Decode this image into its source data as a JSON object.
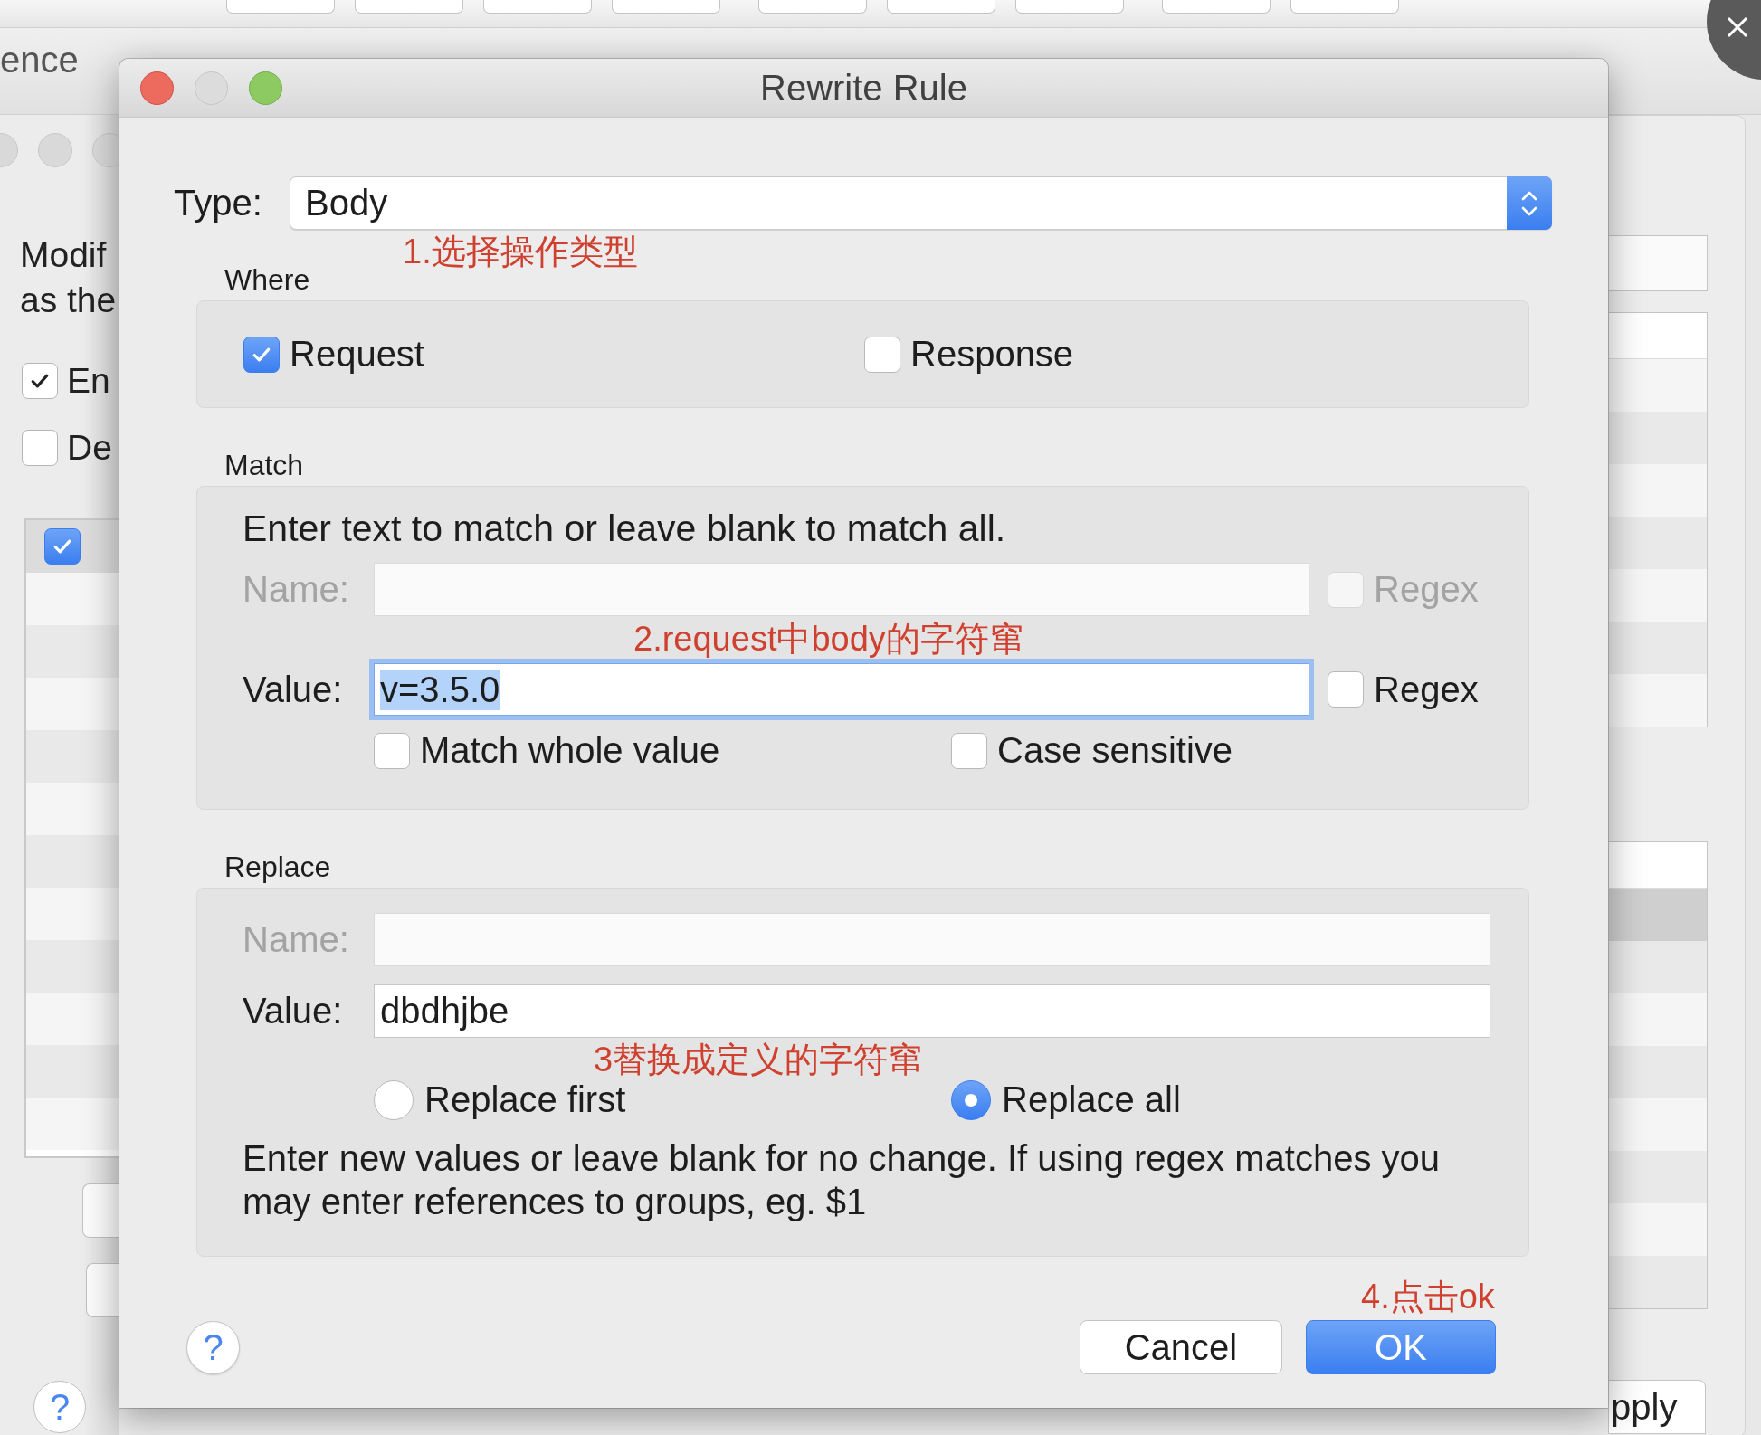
{
  "background_window": {
    "tab_fragment": "ence",
    "description": [
      "Modif",
      "as the"
    ],
    "options": [
      {
        "label": "En",
        "checked": true
      },
      {
        "label": "De",
        "checked": false
      }
    ],
    "table": {
      "header_checked": true
    },
    "help_button": "?",
    "apply_button": "pply"
  },
  "dialog": {
    "title": "Rewrite Rule",
    "type": {
      "label": "Type:",
      "value": "Body"
    },
    "where": {
      "title": "Where",
      "options": [
        {
          "label": "Request",
          "checked": true
        },
        {
          "label": "Response",
          "checked": false
        }
      ]
    },
    "match": {
      "title": "Match",
      "hint": "Enter text to match or leave blank to match all.",
      "fields": [
        {
          "label": "Name:",
          "disabled": true,
          "focused": false,
          "regex": {
            "label": "Regex",
            "checked": false,
            "disabled": true
          }
        },
        {
          "label": "Value:",
          "value": "v=3.5.0",
          "disabled": false,
          "focused": true,
          "text_selected": true,
          "regex": {
            "label": "Regex",
            "checked": false,
            "disabled": false
          }
        }
      ],
      "options": [
        {
          "label": "Match whole value",
          "checked": false
        },
        {
          "label": "Case sensitive",
          "checked": false
        }
      ]
    },
    "replace": {
      "title": "Replace",
      "fields": [
        {
          "label": "Name:",
          "disabled": true
        },
        {
          "label": "Value:",
          "value": "dbdhjbe",
          "disabled": false
        }
      ],
      "modes": [
        {
          "label": "Replace first",
          "selected": false
        },
        {
          "label": "Replace all",
          "selected": true
        }
      ],
      "note": "Enter new values or leave blank for no change. If using regex matches you may enter references to groups, eg. $1"
    },
    "help_button": "?",
    "buttons": [
      {
        "label": "Cancel",
        "kind": "secondary"
      },
      {
        "label": "OK",
        "kind": "default"
      }
    ],
    "annotations": [
      {
        "text": "1.选择操作类型"
      },
      {
        "text": "2.request中body的字符窜"
      },
      {
        "text": "3替换成定义的字符窜"
      },
      {
        "text": "4.点击ok"
      }
    ]
  }
}
